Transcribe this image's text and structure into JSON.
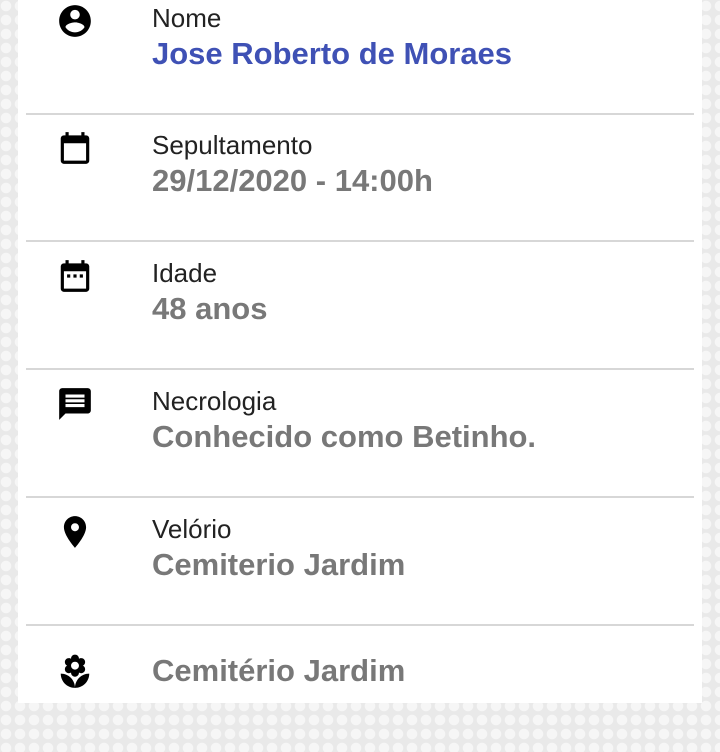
{
  "colors": {
    "accent": "#3f51b5",
    "value_gray": "#787878",
    "label": "#222222",
    "divider": "#d7d7d7"
  },
  "details": [
    {
      "icon": "account-circle-icon",
      "label": "Nome",
      "value": "Jose Roberto de Moraes"
    },
    {
      "icon": "calendar-icon",
      "label": "Sepultamento",
      "value": "29/12/2020 - 14:00h"
    },
    {
      "icon": "calendar-dots-icon",
      "label": "Idade",
      "value": "48 anos"
    },
    {
      "icon": "message-icon",
      "label": "Necrologia",
      "value": "Conhecido como Betinho."
    },
    {
      "icon": "location-pin-icon",
      "label": "Velório",
      "value": "Cemiterio Jardim"
    },
    {
      "icon": "flower-icon",
      "label": "",
      "value": "Cemitério Jardim"
    }
  ]
}
